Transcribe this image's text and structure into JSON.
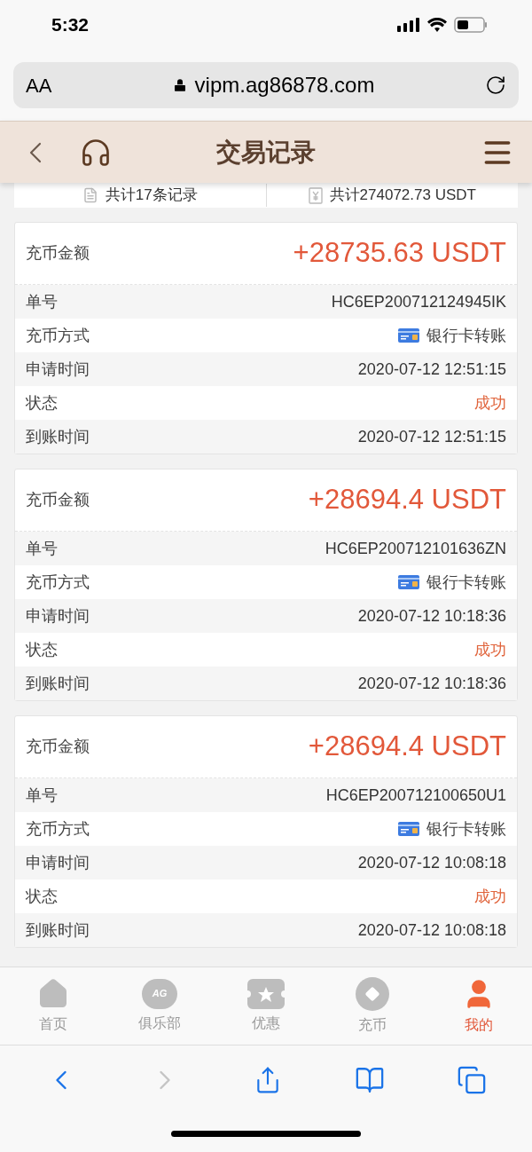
{
  "status_bar": {
    "time": "5:32"
  },
  "browser": {
    "text_size_button": "AA",
    "url": "vipm.ag86878.com"
  },
  "header": {
    "title": "交易记录"
  },
  "summary": [
    {
      "kind": "count",
      "text": "共计17条记录"
    },
    {
      "kind": "total",
      "text": "共计274072.73 USDT"
    }
  ],
  "records": [
    {
      "amount_label": "充币金额",
      "amount": "+28735.63 USDT",
      "rows": [
        {
          "kind": "text",
          "label": "单号",
          "value": "HC6EP200712124945IK"
        },
        {
          "kind": "method",
          "label": "充币方式",
          "value": "银行卡转账"
        },
        {
          "kind": "text",
          "label": "申请时间",
          "value": "2020-07-12 12:51:15"
        },
        {
          "kind": "status",
          "label": "状态",
          "value": "成功"
        },
        {
          "kind": "text",
          "label": "到账时间",
          "value": "2020-07-12 12:51:15"
        }
      ]
    },
    {
      "amount_label": "充币金额",
      "amount": "+28694.4 USDT",
      "rows": [
        {
          "kind": "text",
          "label": "单号",
          "value": "HC6EP200712101636ZN"
        },
        {
          "kind": "method",
          "label": "充币方式",
          "value": "银行卡转账"
        },
        {
          "kind": "text",
          "label": "申请时间",
          "value": "2020-07-12 10:18:36"
        },
        {
          "kind": "status",
          "label": "状态",
          "value": "成功"
        },
        {
          "kind": "text",
          "label": "到账时间",
          "value": "2020-07-12 10:18:36"
        }
      ]
    },
    {
      "amount_label": "充币金额",
      "amount": "+28694.4 USDT",
      "rows": [
        {
          "kind": "text",
          "label": "单号",
          "value": "HC6EP200712100650U1"
        },
        {
          "kind": "method",
          "label": "充币方式",
          "value": "银行卡转账"
        },
        {
          "kind": "text",
          "label": "申请时间",
          "value": "2020-07-12 10:08:18"
        },
        {
          "kind": "status",
          "label": "状态",
          "value": "成功"
        },
        {
          "kind": "text",
          "label": "到账时间",
          "value": "2020-07-12 10:08:18"
        }
      ]
    }
  ],
  "bottom_nav": [
    {
      "kind": "home",
      "label": "首页",
      "selected": false
    },
    {
      "kind": "club",
      "label": "俱乐部",
      "badge": "AG",
      "selected": false
    },
    {
      "kind": "promo",
      "label": "优惠",
      "selected": false
    },
    {
      "kind": "deposit",
      "label": "充币",
      "selected": false
    },
    {
      "kind": "me",
      "label": "我的",
      "selected": true
    }
  ],
  "toolbar": {
    "back_disabled": false,
    "forward_disabled": true
  }
}
